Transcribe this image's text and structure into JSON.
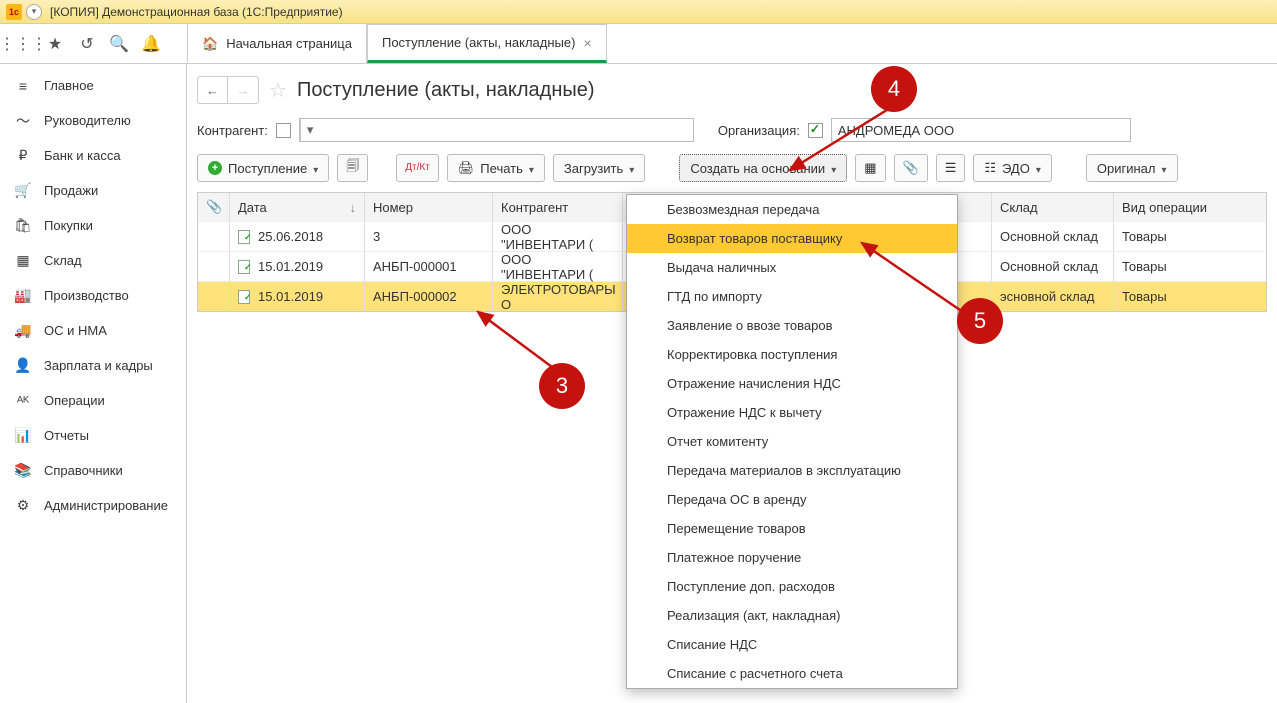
{
  "window_title": "[КОПИЯ] Демонстрационная база  (1С:Предприятие)",
  "tabs": {
    "home": "Начальная страница",
    "active": "Поступление (акты, накладные)"
  },
  "sidebar": {
    "items": [
      {
        "icon": "≡",
        "label": "Главное"
      },
      {
        "icon": "〜",
        "label": "Руководителю"
      },
      {
        "icon": "₽",
        "label": "Банк и касса"
      },
      {
        "icon": "🛒",
        "label": "Продажи"
      },
      {
        "icon": "🛍",
        "label": "Покупки"
      },
      {
        "icon": "▦",
        "label": "Склад"
      },
      {
        "icon": "🏭",
        "label": "Производство"
      },
      {
        "icon": "🚚",
        "label": "ОС и НМА"
      },
      {
        "icon": "👤",
        "label": "Зарплата и кадры"
      },
      {
        "icon": "ᴬᴷ",
        "label": "Операции"
      },
      {
        "icon": "📊",
        "label": "Отчеты"
      },
      {
        "icon": "📚",
        "label": "Справочники"
      },
      {
        "icon": "⚙",
        "label": "Администрирование"
      }
    ]
  },
  "page_title": "Поступление (акты, накладные)",
  "filters": {
    "contractor_label": "Контрагент:",
    "org_label": "Организация:",
    "org_value": "АНДРОМЕДА ООО"
  },
  "toolbar_buttons": {
    "receipt": "Поступление",
    "print": "Печать",
    "load": "Загрузить",
    "based_on": "Создать на основании",
    "edo": "ЭДО",
    "original": "Оригинал"
  },
  "icon_buttons": {
    "dtkt": "Дт/Кт"
  },
  "table": {
    "headers": {
      "date": "Дата",
      "number": "Номер",
      "contractor": "Контрагент",
      "warehouse": "Склад",
      "op_type": "Вид операции"
    },
    "rows": [
      {
        "date": "25.06.2018",
        "number": "3",
        "contractor": "ООО \"ИНВЕНТАРИ (",
        "warehouse": "Основной склад",
        "op": "Товары"
      },
      {
        "date": "15.01.2019",
        "number": "АНБП-000001",
        "contractor": "ООО \"ИНВЕНТАРИ (",
        "warehouse": "Основной склад",
        "op": "Товары"
      },
      {
        "date": "15.01.2019",
        "number": "АНБП-000002",
        "contractor": "ЭЛЕКТРОТОВАРЫ О",
        "warehouse": "эсновной склад",
        "op": "Товары"
      }
    ]
  },
  "menu": {
    "items": [
      "Безвозмездная передача",
      "Возврат товаров поставщику",
      "Выдача наличных",
      "ГТД по импорту",
      "Заявление о ввозе товаров",
      "Корректировка поступления",
      "Отражение начисления НДС",
      "Отражение НДС к вычету",
      "Отчет комитенту",
      "Передача материалов в эксплуатацию",
      "Передача ОС в аренду",
      "Перемещение товаров",
      "Платежное поручение",
      "Поступление доп. расходов",
      "Реализация (акт, накладная)",
      "Списание НДС",
      "Списание с расчетного счета"
    ],
    "highlighted_index": 1
  },
  "callouts": {
    "c3": "3",
    "c4": "4",
    "c5": "5"
  }
}
